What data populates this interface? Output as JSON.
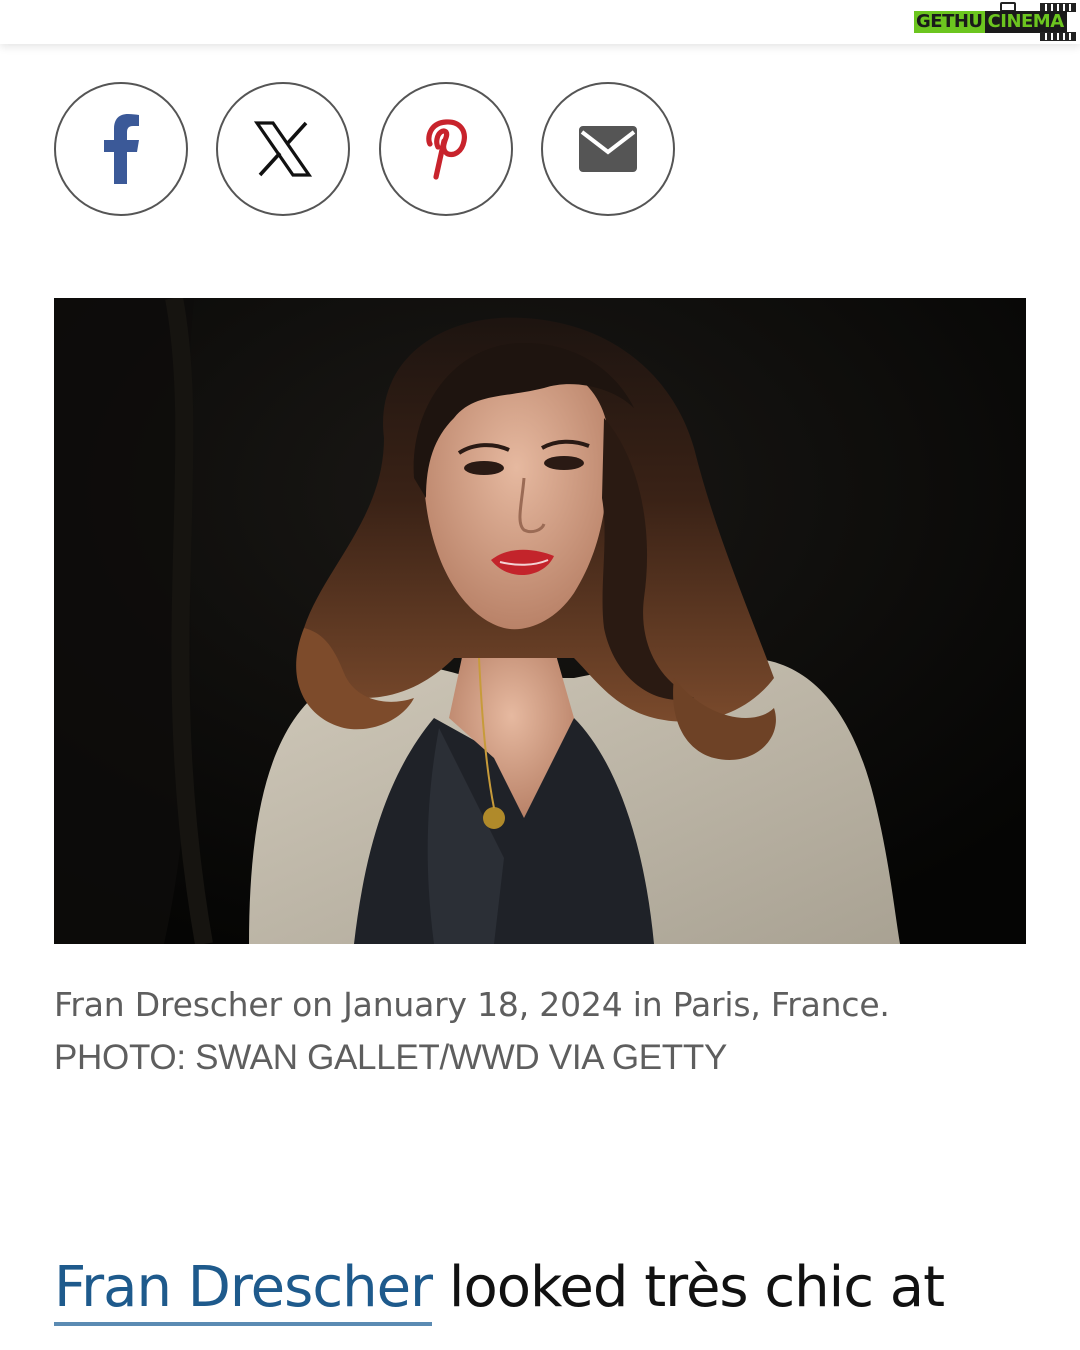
{
  "watermark": {
    "part1": "GETHU",
    "part2": "CINEMA",
    "colors": {
      "green": "#6cc51f",
      "dark": "#1a1a1a"
    }
  },
  "share": {
    "buttons": [
      {
        "name": "facebook",
        "icon": "facebook-icon",
        "color": "#3b5998"
      },
      {
        "name": "x",
        "icon": "x-icon",
        "color": "#111111"
      },
      {
        "name": "pinterest",
        "icon": "pinterest-icon",
        "color": "#c8232c"
      },
      {
        "name": "email",
        "icon": "mail-icon",
        "color": "#555555"
      }
    ]
  },
  "image": {
    "subject": "portrait-photo"
  },
  "caption": {
    "text": "Fran Drescher on January 18, 2024 in Paris, France.",
    "credit": "PHOTO: SWAN GALLET/WWD VIA GETTY"
  },
  "article": {
    "link_text": "Fran Drescher",
    "text_after": " looked très chic at",
    "link_color": "#1e5a8c"
  }
}
